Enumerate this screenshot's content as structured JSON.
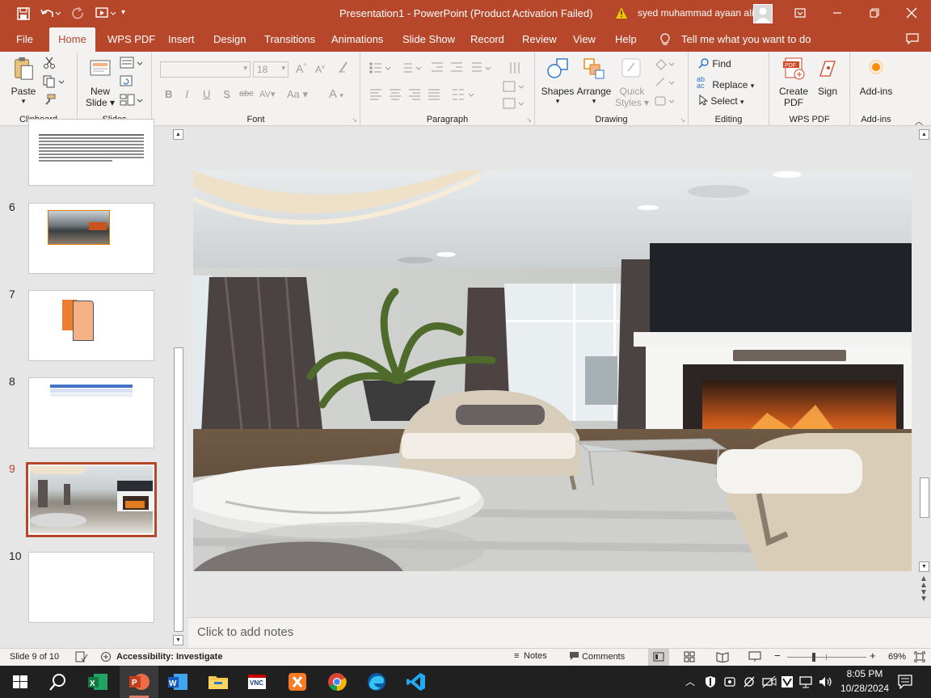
{
  "window": {
    "title": "Presentation1  -  PowerPoint (Product Activation Failed)",
    "user_name": "syed muhammad ayaan ali"
  },
  "tabs": [
    {
      "label": "File"
    },
    {
      "label": "Home"
    },
    {
      "label": "WPS PDF"
    },
    {
      "label": "Insert"
    },
    {
      "label": "Design"
    },
    {
      "label": "Transitions"
    },
    {
      "label": "Animations"
    },
    {
      "label": "Slide Show"
    },
    {
      "label": "Record"
    },
    {
      "label": "Review"
    },
    {
      "label": "View"
    },
    {
      "label": "Help"
    }
  ],
  "tell_me": "Tell me what you want to do",
  "ribbon": {
    "clipboard": {
      "paste": "Paste",
      "label": "Clipboard"
    },
    "slides": {
      "new_slide_1": "New",
      "new_slide_2": "Slide",
      "label": "Slides"
    },
    "font": {
      "font_size": "18",
      "label": "Font"
    },
    "paragraph": {
      "label": "Paragraph"
    },
    "drawing": {
      "shapes": "Shapes",
      "arrange": "Arrange",
      "quick_styles_1": "Quick",
      "quick_styles_2": "Styles",
      "label": "Drawing"
    },
    "editing": {
      "find": "Find",
      "replace": "Replace",
      "select": "Select",
      "label": "Editing"
    },
    "wps_pdf": {
      "create_pdf_1": "Create",
      "create_pdf_2": "PDF",
      "sign": "Sign",
      "label": "WPS PDF"
    },
    "addins": {
      "button": "Add-ins",
      "label": "Add-ins"
    }
  },
  "thumbnails": [
    {
      "number": "6"
    },
    {
      "number": "7"
    },
    {
      "number": "8"
    },
    {
      "number": "9"
    },
    {
      "number": "10"
    }
  ],
  "selected_slide": 9,
  "notes_placeholder": "Click to add notes",
  "status": {
    "slide_info": "Slide 9 of 10",
    "accessibility": "Accessibility: Investigate",
    "notes": "Notes",
    "comments": "Comments",
    "zoom": "69%"
  },
  "taskbar": {
    "time": "8:05 PM",
    "date": "10/28/2024"
  },
  "colors": {
    "accent": "#b7472a",
    "ribbon_bg": "#f3f2f1",
    "taskbar": "#202020"
  }
}
